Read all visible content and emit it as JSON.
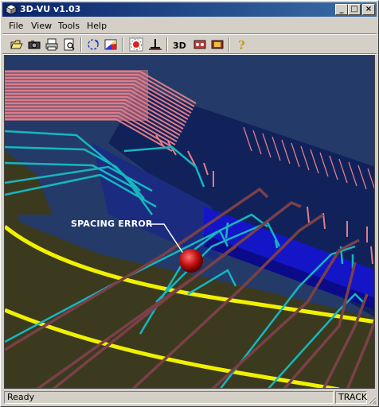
{
  "window": {
    "title": "3D-VU v1.03",
    "controls": {
      "minimize": "_",
      "maximize": "□",
      "close": "×"
    }
  },
  "menu": {
    "items": [
      {
        "label": "File"
      },
      {
        "label": "View"
      },
      {
        "label": "Tools"
      },
      {
        "label": "Help"
      }
    ]
  },
  "toolbar": {
    "icons": [
      "open-icon",
      "camera-icon",
      "print-icon",
      "print-preview-icon",
      "rotate-icon",
      "color-icon",
      "view-point-icon",
      "ground-icon",
      "3d-icon",
      "dataset-icon",
      "dataset-export-icon",
      "help-icon"
    ],
    "label_3d": "3D"
  },
  "viewport": {
    "annotation": "SPACING ERROR"
  },
  "status": {
    "left": "Ready",
    "right": "TRACK"
  },
  "colors": {
    "background": "#243b69",
    "ground": "#3b3a1f",
    "track_line": "#f0f000",
    "pink_wells": "#e07d88",
    "cyan_wells": "#16b6c0",
    "brown_wells": "#7a4048",
    "blue_layer": "#1515c8",
    "marker": "#c01010"
  }
}
